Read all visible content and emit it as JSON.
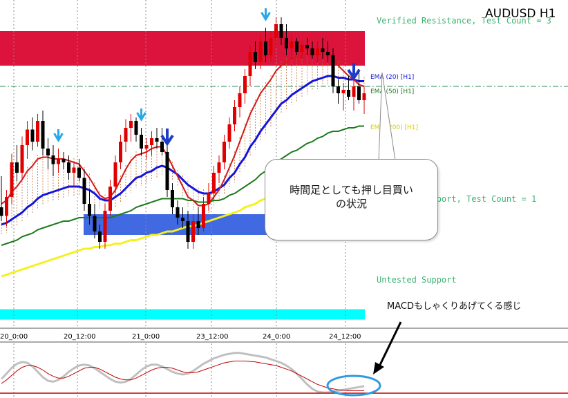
{
  "symbol": "AUDUSD H1",
  "zones": {
    "resistance_label": "Verified Resistance, Test Count = 3",
    "support_label": "Untested Support, Test Count = 1",
    "untested_label": "Untested Support"
  },
  "ema_labels": {
    "ema20": "EMA (20) [H1]",
    "ema50": "EMA (50) [H1]",
    "ema200": "EMA (200) [H1]"
  },
  "callout": {
    "line1": "時間足としても押し目買い",
    "line2": "の状況"
  },
  "macd_note": "MACDもしゃくりあげてくる感じ",
  "colors": {
    "resistance_zone": "#dc143c",
    "support_zone": "#4169e1",
    "untested_zone": "#00ffff",
    "ema_fast": "#d11a1a",
    "ema20": "#1414dc",
    "ema50": "#1e7a1e",
    "ema200": "#f5f01e",
    "bull_candle": "#e00000",
    "bear_candle": "#000000",
    "signal_arrow": "#28a8e6",
    "down_arrow": "#1e3ccc",
    "macd_main": "#c0c0c0",
    "macd_signal": "#c00000",
    "highlight_ellipse": "#2f9ae0"
  },
  "chart_data": {
    "type": "candlestick",
    "x_labels": [
      "20_0:00",
      "20_12:00",
      "21_0:00",
      "23_12:00",
      "24_0:00",
      "24_12:00"
    ],
    "candles": [
      [
        0.735,
        0.7368,
        0.7342,
        0.7345
      ],
      [
        0.7345,
        0.736,
        0.7339,
        0.7356
      ],
      [
        0.7356,
        0.7381,
        0.7352,
        0.7376
      ],
      [
        0.7376,
        0.7386,
        0.7365,
        0.737
      ],
      [
        0.737,
        0.7391,
        0.7366,
        0.7386
      ],
      [
        0.7386,
        0.74,
        0.7378,
        0.7395
      ],
      [
        0.7395,
        0.7402,
        0.7383,
        0.7388
      ],
      [
        0.7388,
        0.7404,
        0.7385,
        0.74
      ],
      [
        0.74,
        0.7406,
        0.738,
        0.7384
      ],
      [
        0.7384,
        0.739,
        0.7372,
        0.738
      ],
      [
        0.738,
        0.7386,
        0.7368,
        0.7375
      ],
      [
        0.7375,
        0.7384,
        0.737,
        0.7378
      ],
      [
        0.7378,
        0.7382,
        0.7372,
        0.7376
      ],
      [
        0.7376,
        0.738,
        0.7366,
        0.737
      ],
      [
        0.737,
        0.7376,
        0.7362,
        0.7373
      ],
      [
        0.7373,
        0.7378,
        0.7365,
        0.7367
      ],
      [
        0.7367,
        0.7372,
        0.7348,
        0.7352
      ],
      [
        0.7352,
        0.736,
        0.734,
        0.7345
      ],
      [
        0.7345,
        0.7352,
        0.7332,
        0.7336
      ],
      [
        0.7336,
        0.734,
        0.7326,
        0.733
      ],
      [
        0.733,
        0.7352,
        0.7326,
        0.7348
      ],
      [
        0.7348,
        0.7366,
        0.7345,
        0.7362
      ],
      [
        0.7362,
        0.738,
        0.7358,
        0.7376
      ],
      [
        0.7376,
        0.7392,
        0.7372,
        0.7388
      ],
      [
        0.7388,
        0.7401,
        0.7382,
        0.7396
      ],
      [
        0.7396,
        0.7404,
        0.7388,
        0.74
      ],
      [
        0.74,
        0.7402,
        0.7388,
        0.7392
      ],
      [
        0.7392,
        0.7396,
        0.738,
        0.7384
      ],
      [
        0.7384,
        0.739,
        0.7378,
        0.7386
      ],
      [
        0.7386,
        0.7394,
        0.738,
        0.739
      ],
      [
        0.739,
        0.7396,
        0.7384,
        0.7388
      ],
      [
        0.7388,
        0.7396,
        0.738,
        0.7382
      ],
      [
        0.7382,
        0.7386,
        0.7356,
        0.736
      ],
      [
        0.736,
        0.7364,
        0.7346,
        0.735
      ],
      [
        0.735,
        0.7354,
        0.734,
        0.7344
      ],
      [
        0.7344,
        0.735,
        0.7338,
        0.7342
      ],
      [
        0.7342,
        0.7348,
        0.7326,
        0.733
      ],
      [
        0.733,
        0.7346,
        0.7326,
        0.7342
      ],
      [
        0.7342,
        0.735,
        0.7334,
        0.7338
      ],
      [
        0.7338,
        0.7356,
        0.7336,
        0.7352
      ],
      [
        0.7352,
        0.7364,
        0.7348,
        0.7358
      ],
      [
        0.7358,
        0.7374,
        0.7354,
        0.737
      ],
      [
        0.737,
        0.738,
        0.7364,
        0.7376
      ],
      [
        0.7376,
        0.7392,
        0.7372,
        0.7388
      ],
      [
        0.7388,
        0.7402,
        0.7384,
        0.7398
      ],
      [
        0.7398,
        0.7412,
        0.7394,
        0.7408
      ],
      [
        0.7408,
        0.742,
        0.7402,
        0.7416
      ],
      [
        0.7416,
        0.743,
        0.741,
        0.7426
      ],
      [
        0.7426,
        0.7444,
        0.742,
        0.744
      ],
      [
        0.744,
        0.7446,
        0.743,
        0.7434
      ],
      [
        0.7434,
        0.745,
        0.743,
        0.7446
      ],
      [
        0.7446,
        0.7454,
        0.7434,
        0.7438
      ],
      [
        0.7438,
        0.7452,
        0.7434,
        0.7448
      ],
      [
        0.7448,
        0.746,
        0.7442,
        0.7456
      ],
      [
        0.7456,
        0.746,
        0.7444,
        0.7448
      ],
      [
        0.7448,
        0.7456,
        0.7438,
        0.7442
      ],
      [
        0.7442,
        0.745,
        0.7436,
        0.7446
      ],
      [
        0.7446,
        0.7448,
        0.7438,
        0.744
      ],
      [
        0.744,
        0.7446,
        0.7436,
        0.7444
      ],
      [
        0.7444,
        0.7448,
        0.7438,
        0.7442
      ],
      [
        0.7442,
        0.7446,
        0.7436,
        0.7438
      ],
      [
        0.7438,
        0.7446,
        0.7434,
        0.7442
      ],
      [
        0.7442,
        0.7448,
        0.7436,
        0.744
      ],
      [
        0.744,
        0.7446,
        0.7434,
        0.7438
      ],
      [
        0.7438,
        0.7442,
        0.7416,
        0.742
      ],
      [
        0.742,
        0.7424,
        0.741,
        0.7416
      ],
      [
        0.7416,
        0.7422,
        0.7406,
        0.7418
      ],
      [
        0.7418,
        0.7426,
        0.7412,
        0.7414
      ],
      [
        0.7414,
        0.7424,
        0.7406,
        0.742
      ],
      [
        0.742,
        0.743,
        0.741,
        0.7412
      ],
      [
        0.7412,
        0.742,
        0.7404,
        0.7416
      ]
    ],
    "ema_fast": [
      0.7352,
      0.7354,
      0.7359,
      0.7362,
      0.7366,
      0.7371,
      0.7374,
      0.7378,
      0.7379,
      0.7379,
      0.7378,
      0.7378,
      0.7378,
      0.7377,
      0.7376,
      0.7375,
      0.7371,
      0.7367,
      0.7362,
      0.7357,
      0.7355,
      0.7356,
      0.736,
      0.7366,
      0.7372,
      0.7377,
      0.738,
      0.7381,
      0.7382,
      0.7384,
      0.7385,
      0.7385,
      0.738,
      0.7374,
      0.7368,
      0.7362,
      0.7356,
      0.7354,
      0.7351,
      0.7351,
      0.7352,
      0.7356,
      0.736,
      0.7366,
      0.7373,
      0.738,
      0.7388,
      0.7396,
      0.7404,
      0.741,
      0.7416,
      0.742,
      0.7424,
      0.7429,
      0.7432,
      0.7434,
      0.7436,
      0.7437,
      0.7438,
      0.7439,
      0.7439,
      0.7439,
      0.7439,
      0.7439,
      0.7436,
      0.7432,
      0.7429,
      0.7426,
      0.7424,
      0.7421,
      0.742
    ],
    "ema20": [
      0.734,
      0.7341,
      0.7343,
      0.7345,
      0.7347,
      0.735,
      0.7352,
      0.7355,
      0.7357,
      0.7358,
      0.7359,
      0.736,
      0.7361,
      0.7362,
      0.7362,
      0.7362,
      0.7361,
      0.736,
      0.7358,
      0.7355,
      0.7354,
      0.7354,
      0.7356,
      0.7358,
      0.7361,
      0.7364,
      0.7367,
      0.7368,
      0.737,
      0.7371,
      0.7373,
      0.7374,
      0.7373,
      0.7371,
      0.7369,
      0.7366,
      0.7363,
      0.7361,
      0.7359,
      0.7358,
      0.7358,
      0.7359,
      0.7361,
      0.7363,
      0.7367,
      0.737,
      0.7375,
      0.7379,
      0.7385,
      0.7389,
      0.7394,
      0.7398,
      0.7402,
      0.7406,
      0.741,
      0.7412,
      0.7415,
      0.7417,
      0.7419,
      0.7421,
      0.7423,
      0.7424,
      0.7425,
      0.7426,
      0.7426,
      0.7425,
      0.7425,
      0.7424,
      0.7424,
      0.7423,
      0.7423
    ],
    "ema50": [
      0.7328,
      0.7329,
      0.733,
      0.7331,
      0.7333,
      0.7334,
      0.7335,
      0.7337,
      0.7338,
      0.7339,
      0.734,
      0.7341,
      0.7342,
      0.7342,
      0.7343,
      0.7344,
      0.7344,
      0.7344,
      0.7344,
      0.7344,
      0.7344,
      0.7344,
      0.7345,
      0.7346,
      0.7347,
      0.7348,
      0.735,
      0.7351,
      0.7352,
      0.7353,
      0.7354,
      0.7355,
      0.7355,
      0.7355,
      0.7355,
      0.7355,
      0.7354,
      0.7354,
      0.7353,
      0.7353,
      0.7353,
      0.7354,
      0.7354,
      0.7355,
      0.7357,
      0.7358,
      0.736,
      0.7362,
      0.7364,
      0.7366,
      0.7369,
      0.7371,
      0.7373,
      0.7376,
      0.7378,
      0.738,
      0.7382,
      0.7383,
      0.7385,
      0.7387,
      0.7388,
      0.739,
      0.7391,
      0.7393,
      0.7394,
      0.7394,
      0.7395,
      0.7396,
      0.7396,
      0.7397,
      0.7397
    ],
    "ema200": [
      0.731,
      0.7311,
      0.7312,
      0.7313,
      0.7314,
      0.7315,
      0.7316,
      0.7317,
      0.7318,
      0.7319,
      0.732,
      0.7321,
      0.7322,
      0.7323,
      0.7324,
      0.7325,
      0.7326,
      0.7326,
      0.7327,
      0.7327,
      0.7328,
      0.7328,
      0.7329,
      0.7329,
      0.733,
      0.7331,
      0.7331,
      0.7332,
      0.7333,
      0.7334,
      0.7334,
      0.7335,
      0.7336,
      0.7336,
      0.7337,
      0.7338,
      0.7339,
      0.7339,
      0.734,
      0.7341,
      0.7342,
      0.7343,
      0.7344,
      0.7345,
      0.7346,
      0.7347,
      0.7348,
      0.735,
      0.7351,
      0.7352,
      0.7354,
      0.7355,
      0.7356,
      0.7358,
      0.7359,
      0.736,
      0.7361,
      0.7362,
      0.7363,
      0.7364,
      0.7365,
      0.7366,
      0.7367,
      0.7368,
      0.7369,
      0.737,
      0.7371,
      0.7372,
      0.7373,
      0.7374,
      0.7375
    ],
    "resistance_zone": [
      0.7432,
      0.7452
    ],
    "support_zone": [
      0.7334,
      0.7346
    ],
    "untested_support_zone": [
      0.7285,
      0.7291
    ],
    "dashdot_level": 0.742,
    "signal_arrows_down": [
      11,
      27,
      51
    ],
    "big_arrows_down": [
      32,
      68
    ],
    "macd_main": [
      0.3,
      0.42,
      0.55,
      0.64,
      0.68,
      0.66,
      0.58,
      0.46,
      0.34,
      0.26,
      0.24,
      0.28,
      0.36,
      0.46,
      0.54,
      0.6,
      0.62,
      0.6,
      0.54,
      0.46,
      0.38,
      0.3,
      0.24,
      0.22,
      0.24,
      0.3,
      0.4,
      0.5,
      0.58,
      0.62,
      0.62,
      0.58,
      0.52,
      0.46,
      0.42,
      0.4,
      0.42,
      0.48,
      0.56,
      0.64,
      0.7,
      0.76,
      0.8,
      0.84,
      0.86,
      0.88,
      0.88,
      0.86,
      0.84,
      0.82,
      0.8,
      0.78,
      0.74,
      0.7,
      0.66,
      0.6,
      0.52,
      0.42,
      0.3,
      0.18,
      0.08,
      0.02,
      0.0,
      0.0,
      0.02,
      0.04,
      0.06,
      0.08,
      0.1,
      0.12,
      0.14
    ],
    "macd_signal": [
      0.2,
      0.28,
      0.38,
      0.48,
      0.56,
      0.6,
      0.6,
      0.56,
      0.5,
      0.42,
      0.36,
      0.32,
      0.32,
      0.36,
      0.42,
      0.48,
      0.54,
      0.56,
      0.56,
      0.52,
      0.46,
      0.4,
      0.34,
      0.3,
      0.28,
      0.28,
      0.32,
      0.38,
      0.44,
      0.5,
      0.54,
      0.56,
      0.56,
      0.54,
      0.5,
      0.46,
      0.44,
      0.44,
      0.46,
      0.5,
      0.54,
      0.58,
      0.62,
      0.66,
      0.68,
      0.7,
      0.7,
      0.7,
      0.69,
      0.68,
      0.66,
      0.64,
      0.62,
      0.6,
      0.56,
      0.52,
      0.48,
      0.42,
      0.36,
      0.3,
      0.24,
      0.18,
      0.14,
      0.1,
      0.08,
      0.06,
      0.05,
      0.04,
      0.04,
      0.04,
      0.04
    ],
    "ylim": [
      0.728,
      0.747
    ]
  }
}
